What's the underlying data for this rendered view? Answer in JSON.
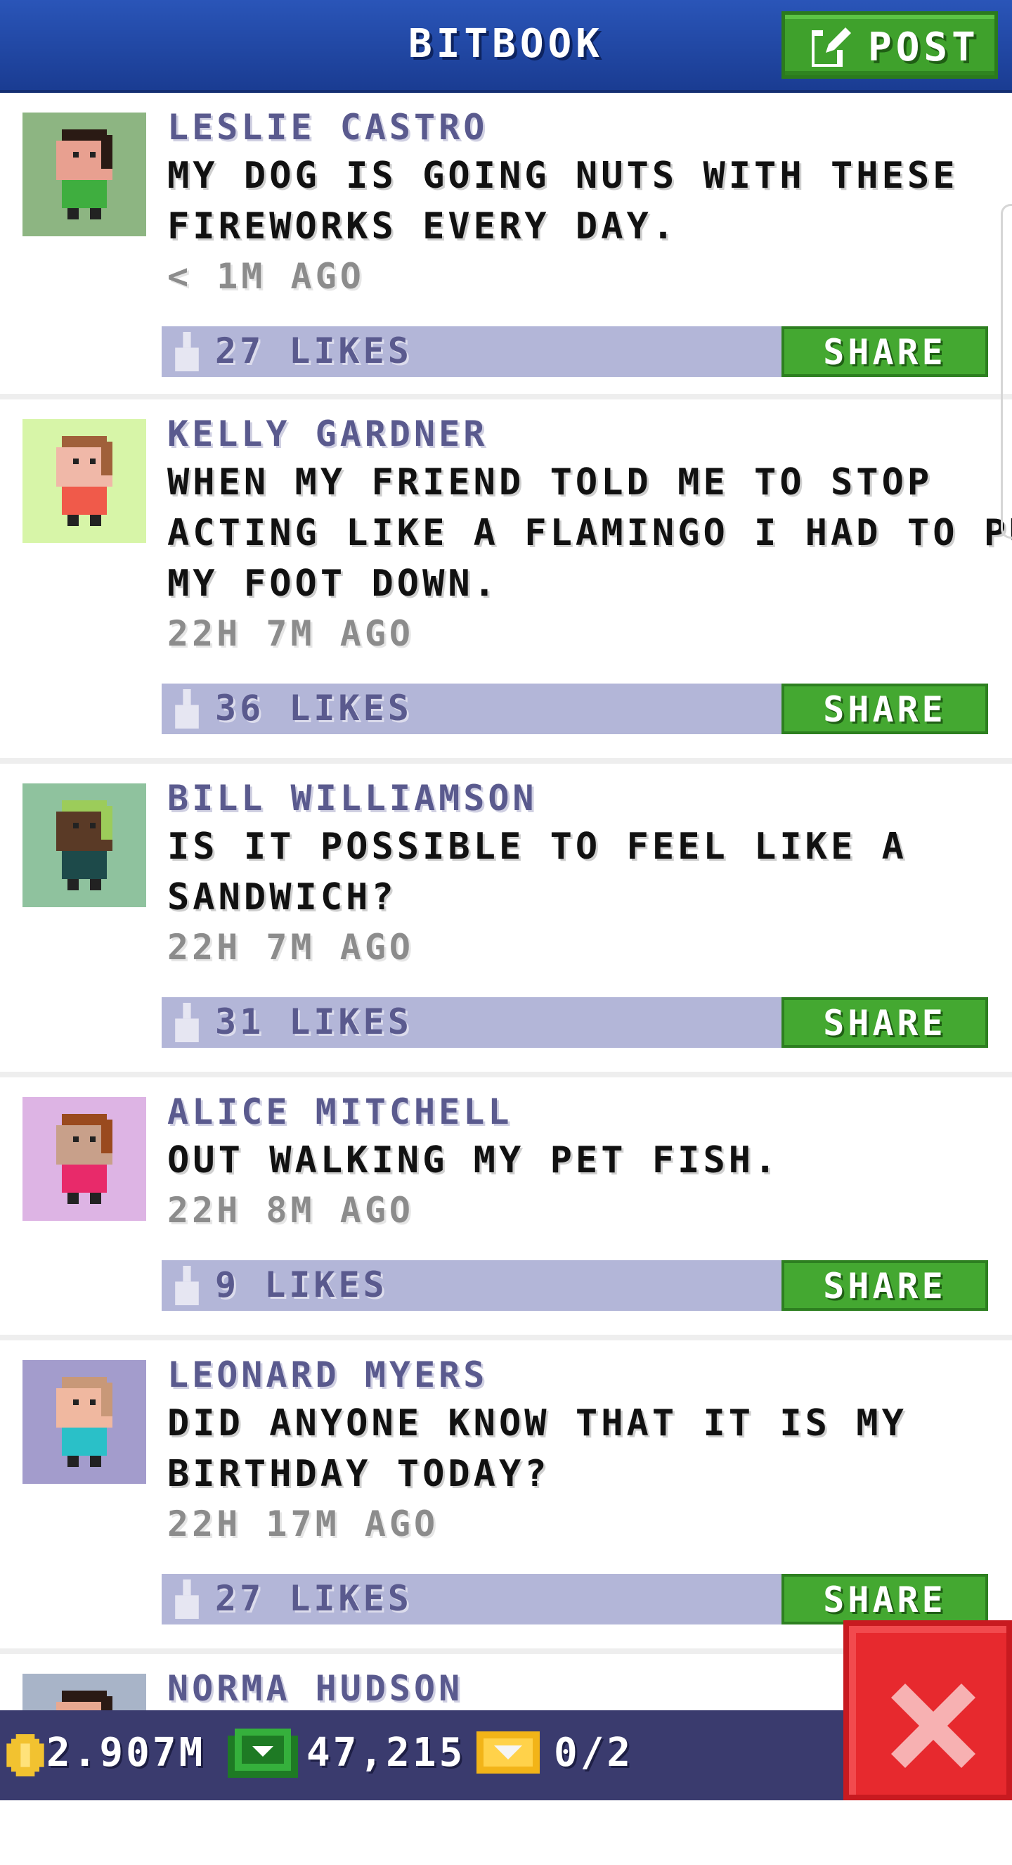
{
  "header": {
    "title": "BITBOOK",
    "post_label": "POST"
  },
  "posts": [
    {
      "name": "LESLIE CASTRO",
      "lines": [
        "MY DOG IS GOING NUTS WITH THESE",
        "FIREWORKS EVERY DAY."
      ],
      "time": "< 1M AGO",
      "likes": "27 LIKES",
      "share": "SHARE",
      "avatar_bg": "#8db582",
      "skin": "#e8a090",
      "hair": "#2a1a14",
      "shirt": "#3fae3f"
    },
    {
      "name": "KELLY GARDNER",
      "lines": [
        "WHEN MY FRIEND TOLD ME TO STOP",
        "ACTING LIKE A FLAMINGO I HAD TO PUT",
        "MY FOOT DOWN."
      ],
      "time": "22H 7M AGO",
      "likes": "36 LIKES",
      "share": "SHARE",
      "avatar_bg": "#d7f5a8",
      "skin": "#f0b8a8",
      "hair": "#a0603a",
      "shirt": "#f05a4a"
    },
    {
      "name": "BILL WILLIAMSON",
      "lines": [
        "IS IT POSSIBLE TO FEEL LIKE A",
        "SANDWICH?"
      ],
      "time": "22H 7M AGO",
      "likes": "31 LIKES",
      "share": "SHARE",
      "avatar_bg": "#8fc29e",
      "skin": "#5a3a26",
      "hair": "#9ccc5a",
      "shirt": "#1d4a4a"
    },
    {
      "name": "ALICE MITCHELL",
      "lines": [
        "OUT WALKING MY PET FISH."
      ],
      "time": "22H 8M AGO",
      "likes": "9 LIKES",
      "share": "SHARE",
      "avatar_bg": "#ddb4e4",
      "skin": "#c8a08a",
      "hair": "#9a4a1e",
      "shirt": "#e82a6a"
    },
    {
      "name": "LEONARD MYERS",
      "lines": [
        "DID ANYONE KNOW THAT IT IS MY",
        "BIRTHDAY TODAY?"
      ],
      "time": "22H 17M AGO",
      "likes": "27 LIKES",
      "share": "SHARE",
      "avatar_bg": "#a39ccc",
      "skin": "#f0b8a0",
      "hair": "#c89878",
      "shirt": "#2ac0c8"
    },
    {
      "name": "NORMA HUDSON",
      "lines": [],
      "time": "",
      "likes": "",
      "share": "",
      "avatar_bg": "#a8b4c8",
      "skin": "#e8a890",
      "hair": "#2a1a14",
      "shirt": "#4060a0"
    }
  ],
  "footer": {
    "coins": "2.907M",
    "bux": "47,215",
    "tickets": "0/2"
  },
  "colors": {
    "header_blue": "#1f47a8",
    "green": "#44a831",
    "like_bar": "#b3b6d8",
    "bottom_bar": "#3a3b6e",
    "close_red": "#e7292e"
  },
  "icons": [
    "edit-icon",
    "thumbs-up-icon",
    "coin-icon",
    "bux-icon",
    "ticket-icon",
    "close-icon"
  ]
}
